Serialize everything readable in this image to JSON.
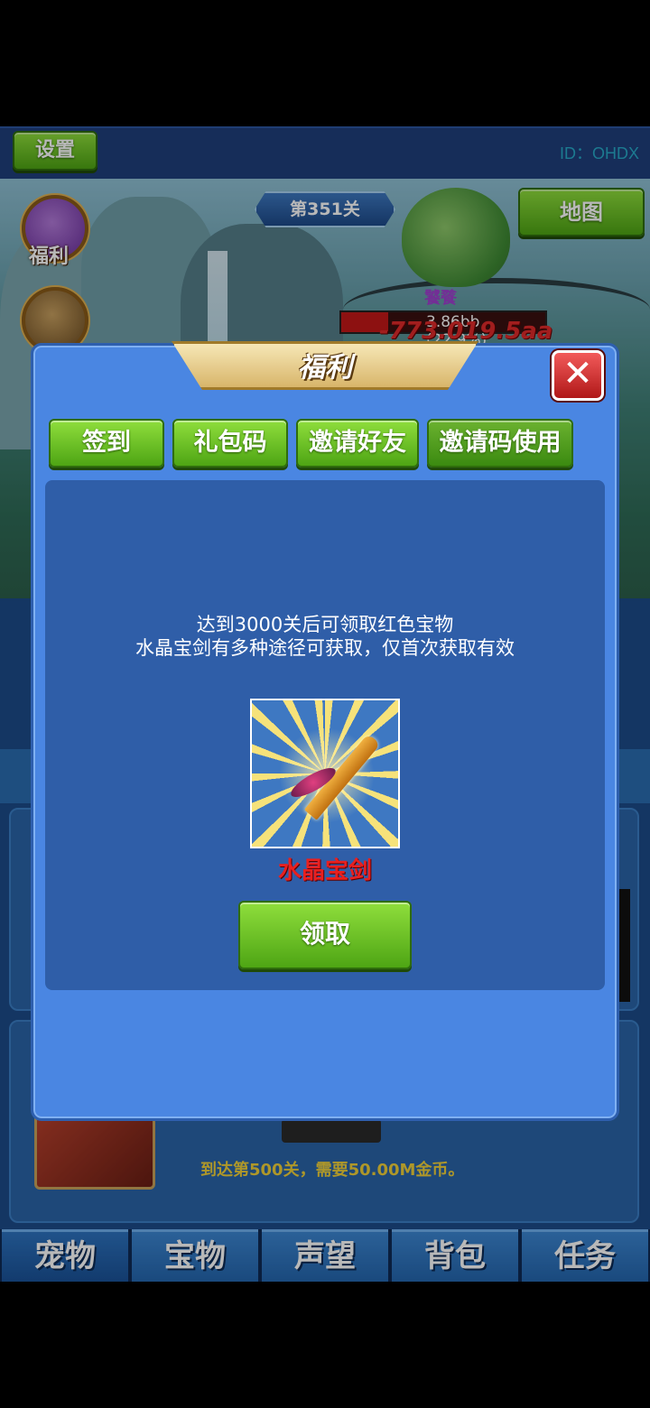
{
  "top_bar": {
    "settings_label": "设置",
    "player_id": "ID：OHDX"
  },
  "scene": {
    "stage_label": "第351关",
    "map_label": "地图",
    "side_icons": [
      {
        "label": "福利",
        "icon": "gift-icon"
      },
      {
        "label": "",
        "icon": "treasure-chest-icon"
      }
    ],
    "boss": {
      "name": "饕餮",
      "hp_text": "3.86bb (22.9%)",
      "hp_percent": 22.9,
      "damage_text": "-773.019.5aa"
    }
  },
  "background_panel": {
    "requirement_text": "到达第500关，需要50.00M金币。"
  },
  "bottom_nav": {
    "tabs": [
      "宠物",
      "宝物",
      "声望",
      "背包",
      "任务"
    ]
  },
  "dialog": {
    "title": "福利",
    "close_icon": "close-icon",
    "tabs": [
      "签到",
      "礼包码",
      "邀请好友",
      "邀请码使用"
    ],
    "active_tab": "邀请码使用",
    "description_line1": "达到3000关后可领取红色宝物",
    "description_line2": "水晶宝剑有多种途径可获取，仅首次获取有效",
    "reward_icon": "crystal-sword-icon",
    "reward_name": "水晶宝剑",
    "claim_label": "领取",
    "colors": {
      "reward_name": "#e82020",
      "panel": "#4a86e2",
      "button_green": "#6cc226"
    }
  }
}
